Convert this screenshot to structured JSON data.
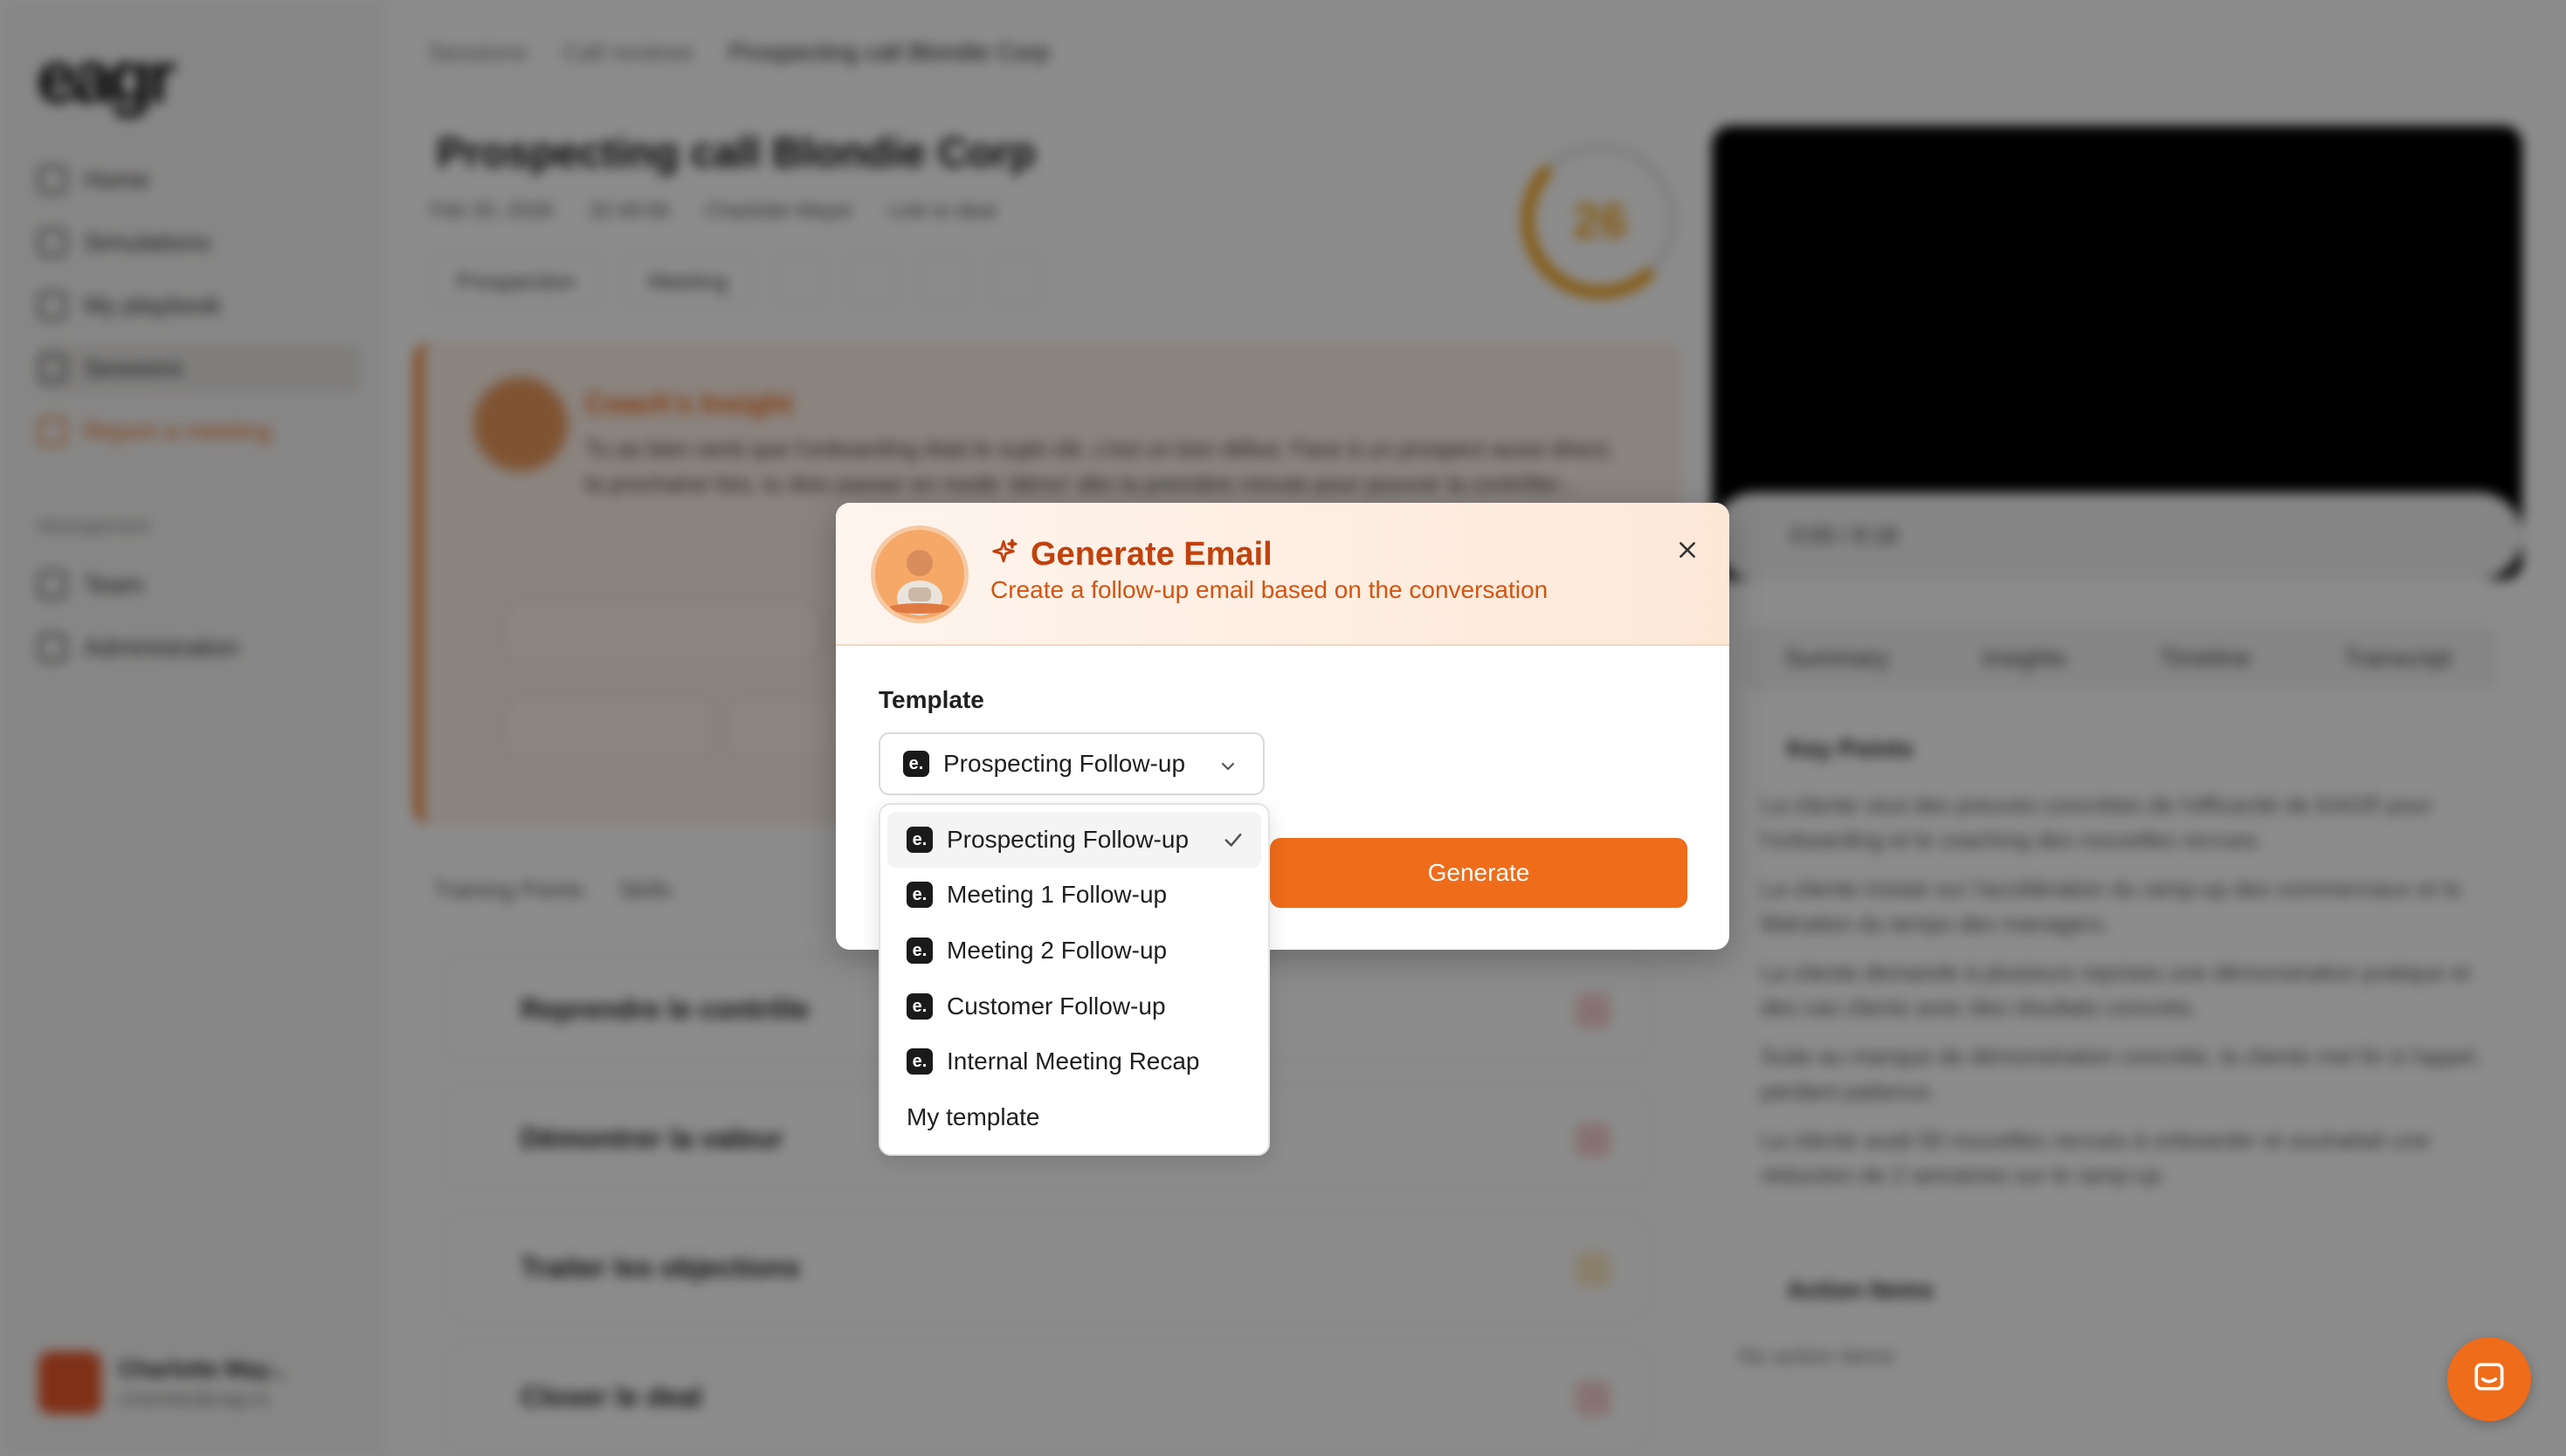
{
  "app": {
    "logo": "eagr",
    "nav": [
      {
        "label": "Home"
      },
      {
        "label": "Simulations"
      },
      {
        "label": "My playbook"
      },
      {
        "label": "Sessions"
      },
      {
        "label": "Report a meeting"
      }
    ],
    "nav_section": "Management",
    "nav_management": [
      {
        "label": "Team"
      },
      {
        "label": "Administration"
      }
    ],
    "user": {
      "name": "Charlotte May...",
      "email": "charlotte@eagr.io"
    },
    "breadcrumb": [
      "Sessions",
      "Call reviews",
      "Prospecting call Blondie Corp"
    ],
    "page_title": "Prospecting call Blondie Corp",
    "meta": [
      "Feb 20, 2026",
      "32:49:06",
      "Charlotte Mayer",
      "Link to deal"
    ],
    "tools": [
      "Prospection",
      "Meeting"
    ],
    "score": "26",
    "insight": {
      "title": "Coach's Insight",
      "text": "Tu as bien senti que l'onboarding était le sujet clé, c'est un bon début. Face à un prospect aussi direct, la prochaine fois, tu dois passer en mode 'démo' dès la première minute pour pouvoir la contrôler..."
    },
    "section_tabs": [
      "Training Points",
      "Skills"
    ],
    "accordions": [
      "Reprendre le contrôle",
      "Démontrer la valeur",
      "Traiter les objections",
      "Closer le deal"
    ],
    "video": {
      "time": "0:00 / 8:18"
    },
    "right_tabs": [
      "Summary",
      "Insights",
      "Timeline",
      "Transcript"
    ],
    "key_points_title": "Key Points",
    "key_points": [
      "La cliente veut des preuves concrètes de l'efficacité de EAGR pour l'onboarding et le coaching des nouvelles recrues.",
      "La cliente insiste sur l'accélération du ramp-up des commerciaux et la libération du temps des managers.",
      "La cliente demande à plusieurs reprises une démonstration pratique et des cas clients avec des résultats concrets.",
      "Suite au manque de démonstration concrète, la cliente met fin à l'appel, perdant patience.",
      "La cliente avait 50 nouvelles recrues à onboarder et souhaitait une réduction de 2 semaines sur le ramp-up."
    ],
    "action_items_title": "Action Items",
    "action_items_empty": "No action items"
  },
  "modal": {
    "title": "Generate Email",
    "subtitle": "Create a follow-up email based on the conversation",
    "template_label": "Template",
    "selected_template": "Prospecting Follow-up",
    "generate_label": "Generate",
    "badge_letter": "e."
  },
  "dropdown": {
    "options": [
      {
        "label": "Prospecting Follow-up",
        "icon": "eagr-badge",
        "selected": true
      },
      {
        "label": "Meeting 1 Follow-up",
        "icon": "eagr-badge"
      },
      {
        "label": "Meeting 2 Follow-up",
        "icon": "eagr-badge"
      },
      {
        "label": "Customer Follow-up",
        "icon": "eagr-badge"
      },
      {
        "label": "Internal Meeting Recap",
        "icon": "eagr-badge"
      },
      {
        "label": "My template",
        "icon": "none"
      }
    ]
  },
  "colors": {
    "accent": "#ef6c1a",
    "title": "#c2410c",
    "overlay": "rgba(0,0,0,0.45)"
  }
}
